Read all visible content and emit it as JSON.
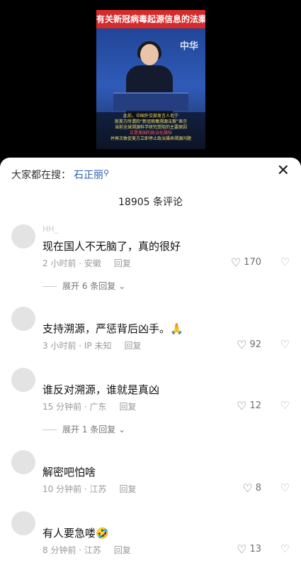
{
  "video": {
    "title": "有关新冠病毒起源信息的法案",
    "background_text": "中华",
    "subtitle_lines": [
      "此前，中国外交部发言人毛宁",
      "就美方所谓的“新冠病毒溯源法案”表示",
      "当前全球溯源科学研究受阻的主要原因",
      "正是美国的政治化操纵",
      "并再次敦促美方立即停止政治操弄溯源问题"
    ]
  },
  "sheet": {
    "search_label": "大家都在搜：",
    "search_term": "石正丽",
    "search_icon": "search-icon",
    "close_icon": "close-icon",
    "comment_count": "18905 条评论"
  },
  "comments": [
    {
      "user": "HH_",
      "text": "现在国人不无脑了，真的很好",
      "time": "2 小时前 · 安徽",
      "reply": "回复",
      "likes": "170",
      "expand": "展开 6 条回复"
    },
    {
      "user": "",
      "text": "支持溯源，严惩背后凶手。🙏",
      "time": "3 小时前 · IP 未知",
      "reply": "回复",
      "likes": "92",
      "expand": ""
    },
    {
      "user": "",
      "text": "谁反对溯源，谁就是真凶",
      "time": "15 分钟前 · 广东",
      "reply": "回复",
      "likes": "12",
      "expand": "展开 1 条回复"
    },
    {
      "user": "",
      "text": "解密吧怕啥",
      "time": "10 分钟前 · 江苏",
      "reply": "回复",
      "likes": "8",
      "expand": ""
    },
    {
      "user": "",
      "text": "有人要急喽🤣",
      "time": "8 分钟前 · 江苏",
      "reply": "回复",
      "likes": "13",
      "expand": ""
    }
  ],
  "colors": {
    "accent": "#2a5db0",
    "banner": "#d62b2b"
  }
}
